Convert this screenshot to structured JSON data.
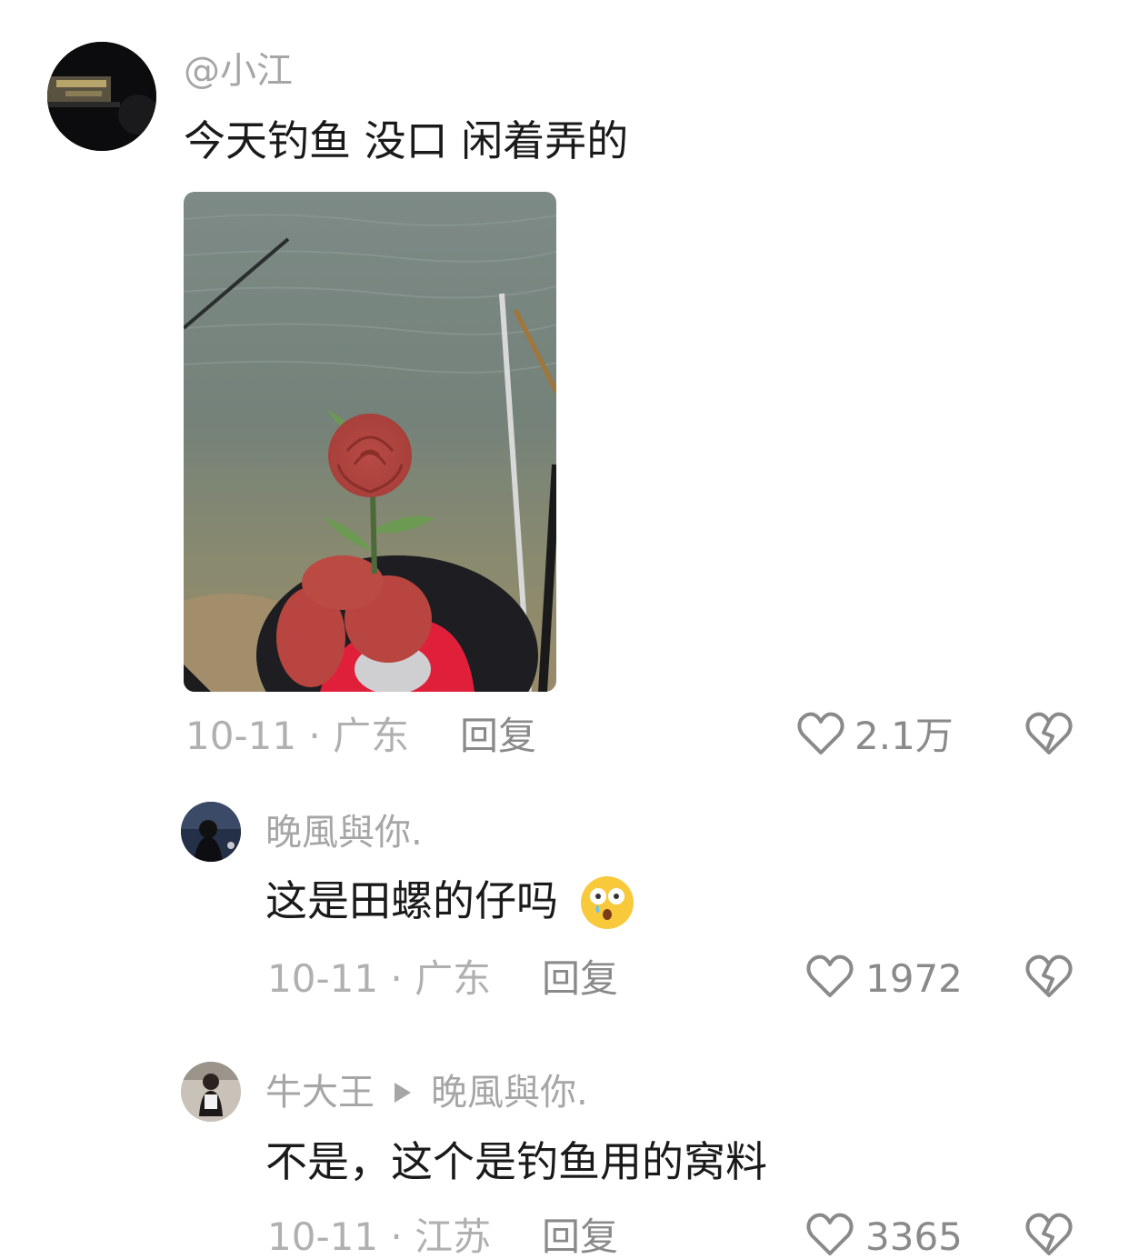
{
  "comment1": {
    "username": "@小江",
    "text": "今天钓鱼 没口 闲着弄的",
    "date": "10-11",
    "location": "广东",
    "reply_label": "回复",
    "likes": "2.1万"
  },
  "comment2": {
    "username": "晚風與你.",
    "text": "这是田螺的仔吗",
    "emoji": "😲",
    "date": "10-11",
    "location": "广东",
    "reply_label": "回复",
    "likes": "1972"
  },
  "comment3": {
    "username": "牛大王",
    "reply_to": "晚風與你.",
    "text": "不是，这个是钓鱼用的窝料",
    "date": "10-11",
    "location": "江苏",
    "reply_label": "回复",
    "likes": "3365"
  },
  "icons": {
    "like": "heart-outline-icon",
    "dislike": "broken-heart-icon",
    "reply_arrow": "triangle-right-icon"
  },
  "colors": {
    "text": "#1a1a1a",
    "username": "#a6a6a6",
    "meta": "#b0b0b0",
    "action": "#8a8a8a"
  }
}
